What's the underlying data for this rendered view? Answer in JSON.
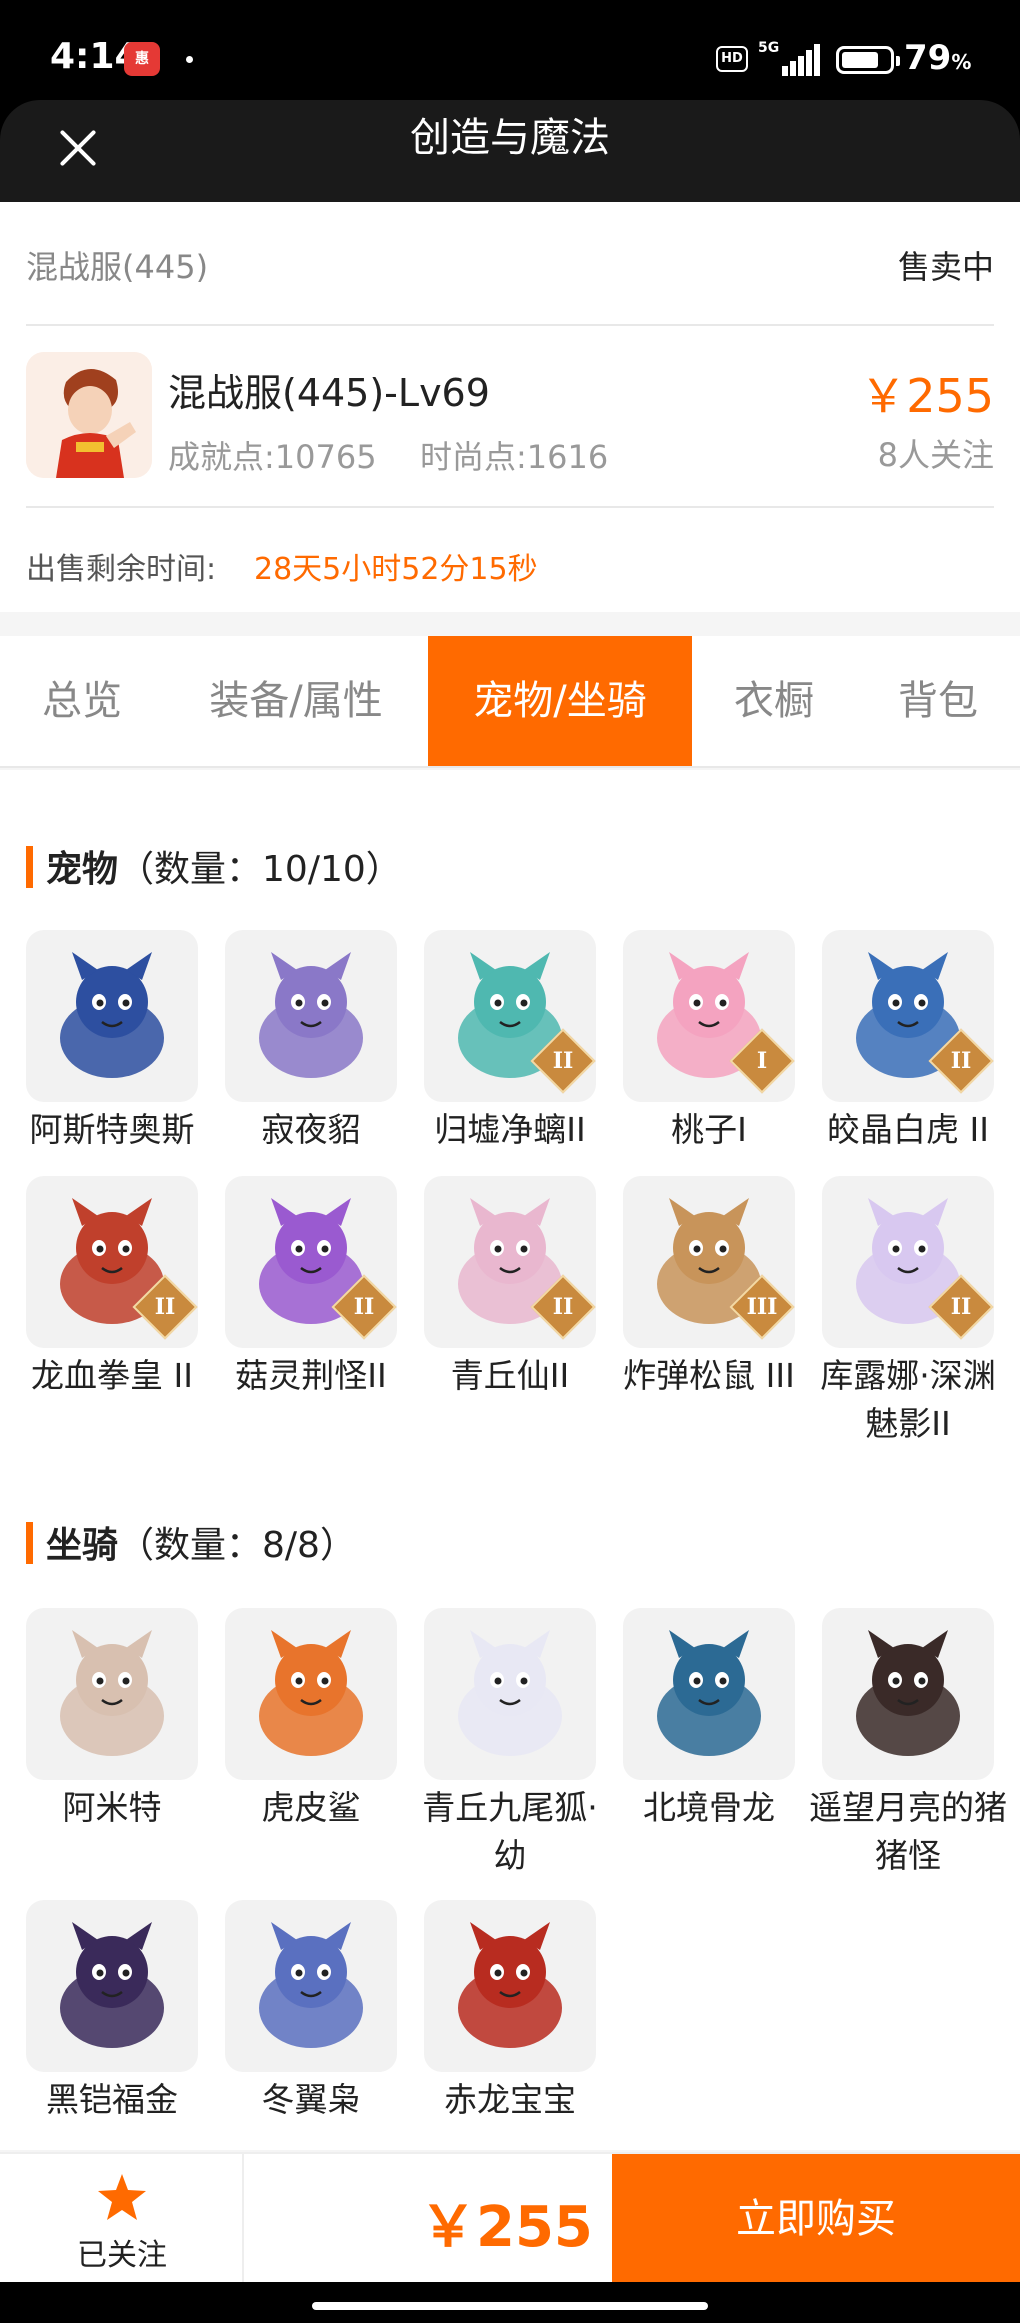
{
  "status_bar": {
    "time": "4:14",
    "app_badge": "惠",
    "network": "5G",
    "hd": "HD",
    "battery": "79",
    "battery_unit": "%",
    "battery_level": 0.79
  },
  "header": {
    "title": "创造与魔法",
    "close_icon": "close-icon"
  },
  "account": {
    "server": "混战服(445)",
    "status": "售卖中",
    "character_name": "混战服(445)-Lv69",
    "achievement": "成就点:10765",
    "fashion": "时尚点:1616",
    "price": "￥255",
    "followers": "8人关注",
    "remain_label": "出售剩余时间:",
    "remain_value": "28天5小时52分15秒"
  },
  "tabs": [
    {
      "label": "总览",
      "active": false
    },
    {
      "label": "装备/属性",
      "active": false
    },
    {
      "label": "宠物/坐骑",
      "active": true
    },
    {
      "label": "衣橱",
      "active": false
    },
    {
      "label": "背包",
      "active": false
    }
  ],
  "pets": {
    "title": "宠物",
    "count": "（数量：10/10）",
    "items": [
      {
        "name": "阿斯特奥斯",
        "badge": "",
        "color": "#2d4fa0"
      },
      {
        "name": "寂夜貂",
        "badge": "",
        "color": "#8a78c8"
      },
      {
        "name": "归墟净螭II",
        "badge": "II",
        "color": "#4fb8b0"
      },
      {
        "name": "桃子I",
        "badge": "I",
        "color": "#f4a3c0"
      },
      {
        "name": "皎晶白虎 II",
        "badge": "II",
        "color": "#3a6fb8"
      },
      {
        "name": "龙血拳皇 II",
        "badge": "II",
        "color": "#c0402c"
      },
      {
        "name": "菇灵荆怪II",
        "badge": "II",
        "color": "#9a5ad0"
      },
      {
        "name": "青丘仙II",
        "badge": "II",
        "color": "#e9b7cf"
      },
      {
        "name": "炸弹松鼠 III",
        "badge": "III",
        "color": "#c8945a"
      },
      {
        "name": "库露娜·深渊魅影II",
        "badge": "II",
        "color": "#d8c8f0"
      }
    ]
  },
  "mounts": {
    "title": "坐骑",
    "count": "（数量：8/8）",
    "items": [
      {
        "name": "阿米特",
        "color": "#d8c0b0"
      },
      {
        "name": "虎皮鲨",
        "color": "#e8742c"
      },
      {
        "name": "青丘九尾狐·幼",
        "color": "#e8e8f4"
      },
      {
        "name": "北境骨龙",
        "color": "#2c6a94"
      },
      {
        "name": "遥望月亮的猪猪怪",
        "color": "#3a2a28"
      },
      {
        "name": "黑铠福金",
        "color": "#3a2a5a"
      },
      {
        "name": "冬翼枭",
        "color": "#5a70c0"
      },
      {
        "name": "赤龙宝宝",
        "color": "#b82c20"
      }
    ]
  },
  "bottom_bar": {
    "favorite_label": "已关注",
    "price": "￥255",
    "buy_label": "立即购买"
  },
  "colors": {
    "accent": "#ff6a00",
    "header_bg": "#1a1a1a"
  }
}
